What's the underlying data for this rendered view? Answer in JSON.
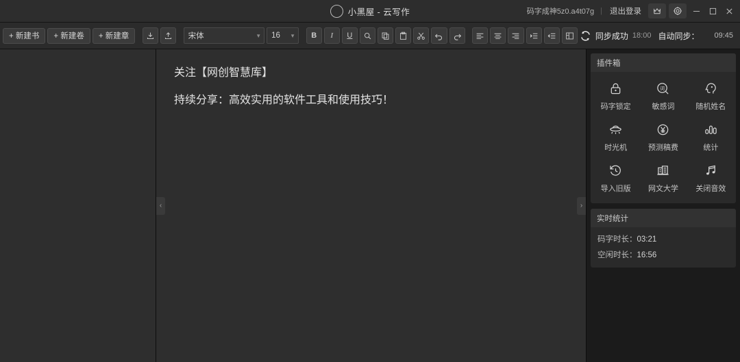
{
  "titlebar": {
    "logo_icon": "compass-icon",
    "title": "小黑屋 - 云写作",
    "user_name": "码字成神5z0.a4t07g",
    "separator": "|",
    "logout_label": "退出登录",
    "crown_icon": "crown-icon",
    "settings_icon": "gear-icon",
    "minimize_icon": "minimize-icon",
    "maximize_icon": "maximize-icon",
    "close_icon": "close-icon"
  },
  "toolbar": {
    "new_book": "+ 新建书",
    "new_volume": "+ 新建卷",
    "new_chapter": "+ 新建章",
    "import_icon": "import-icon",
    "export_icon": "export-icon",
    "font_family": "宋体",
    "font_size": "16",
    "bold": "B",
    "italic": "I",
    "underline": "U",
    "find_icon": "search-icon",
    "copy_icon": "copy-icon",
    "paste_icon": "paste-icon",
    "cut_icon": "scissors-icon",
    "undo_icon": "undo-icon",
    "redo_icon": "redo-icon",
    "align_left_icon": "align-left-icon",
    "align_center_icon": "align-center-icon",
    "align_right_icon": "align-right-icon",
    "indent_increase_icon": "indent-increase-icon",
    "indent_decrease_icon": "indent-decrease-icon",
    "layout_icon": "layout-icon"
  },
  "sync": {
    "refresh_icon": "refresh-icon",
    "status_label": "同步成功",
    "status_time": "18:00",
    "auto_label": "自动同步：",
    "auto_time": "09:45"
  },
  "editor": {
    "collapse_left_icon": "chevron-left-icon",
    "collapse_right_icon": "chevron-right-icon",
    "lines": [
      "关注【网创智慧库】",
      "持续分享：高效实用的软件工具和使用技巧！"
    ]
  },
  "plugins": {
    "title": "插件箱",
    "items": [
      {
        "label": "码字锁定",
        "icon": "lock-icon"
      },
      {
        "label": "敏感词",
        "icon": "word-circle-icon"
      },
      {
        "label": "随机姓名",
        "icon": "head-icon"
      },
      {
        "label": "时光机",
        "icon": "ufo-icon"
      },
      {
        "label": "预测稿费",
        "icon": "yen-circle-icon"
      },
      {
        "label": "统计",
        "icon": "bar-chart-icon"
      },
      {
        "label": "导入旧版",
        "icon": "history-icon"
      },
      {
        "label": "网文大学",
        "icon": "building-icon"
      },
      {
        "label": "关闭音效",
        "icon": "music-note-icon"
      }
    ]
  },
  "stats": {
    "title": "实时统计",
    "writing_label": "码字时长：",
    "writing_value": "03:21",
    "idle_label": "空闲时长：",
    "idle_value": "16:56"
  },
  "colors": {
    "titlebar_bg": "#2d2d2d",
    "toolbar_bg": "#2b2b2b",
    "panel_bg": "#2e2e2e",
    "card_bg": "#2a2a2a",
    "app_bg": "#1b1b1b",
    "text": "#cfcfcf"
  }
}
